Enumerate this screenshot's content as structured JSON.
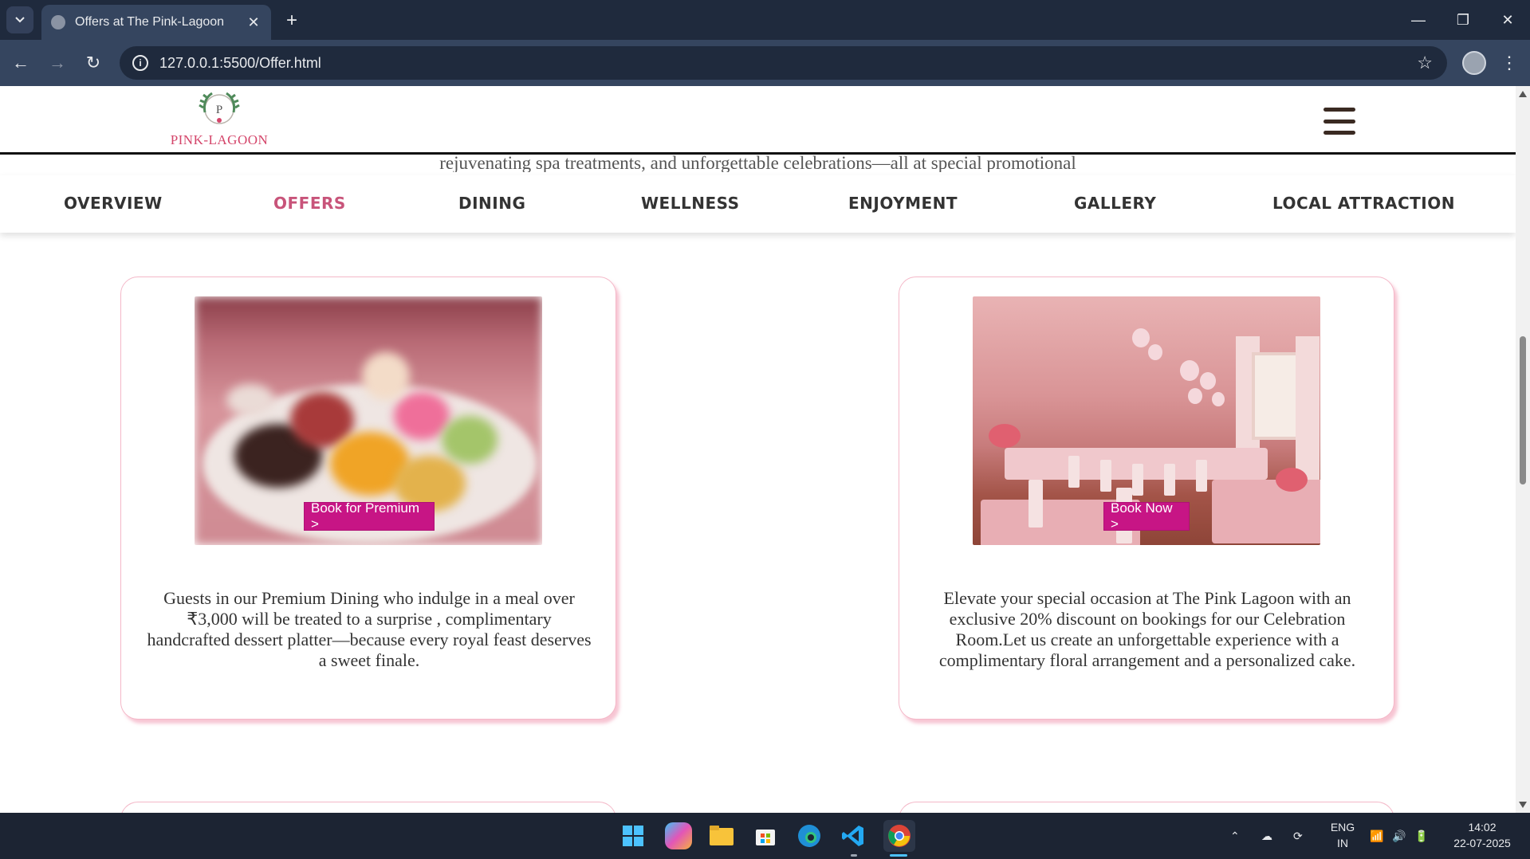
{
  "browser": {
    "tab_title": "Offers at The Pink-Lagoon",
    "url": "127.0.0.1:5500/Offer.html"
  },
  "site": {
    "logo_letter": "P",
    "logo_text": "PINK-LAGOON",
    "intro_partial": "rejuvenating spa treatments, and unforgettable celebrations—all at special promotional",
    "nav": [
      "OVERVIEW",
      "OFFERS",
      "DINING",
      "WELLNESS",
      "ENJOYMENT",
      "GALLERY",
      "LOCAL ATTRACTION"
    ],
    "active_nav": "OFFERS",
    "accent_color": "#c8547a",
    "button_color": "#c71585"
  },
  "offers": [
    {
      "text": "Guests in our Premium Dining who indulge in a meal over ₹3,000 will be treated to a surprise , complimentary handcrafted dessert platter—because every royal feast deserves a sweet finale.",
      "button": "Book for Premium >",
      "image": "dessert-platter-image"
    },
    {
      "text": "Elevate your special occasion at The Pink Lagoon with an exclusive 20% discount on bookings for our Celebration Room.Let us create an unforgettable experience with a complimentary floral arrangement and a personalized cake.",
      "button": "Book Now >",
      "image": "celebration-room-image"
    }
  ],
  "taskbar": {
    "lang_line1": "ENG",
    "lang_line2": "IN",
    "time": "14:02",
    "date": "22-07-2025"
  }
}
